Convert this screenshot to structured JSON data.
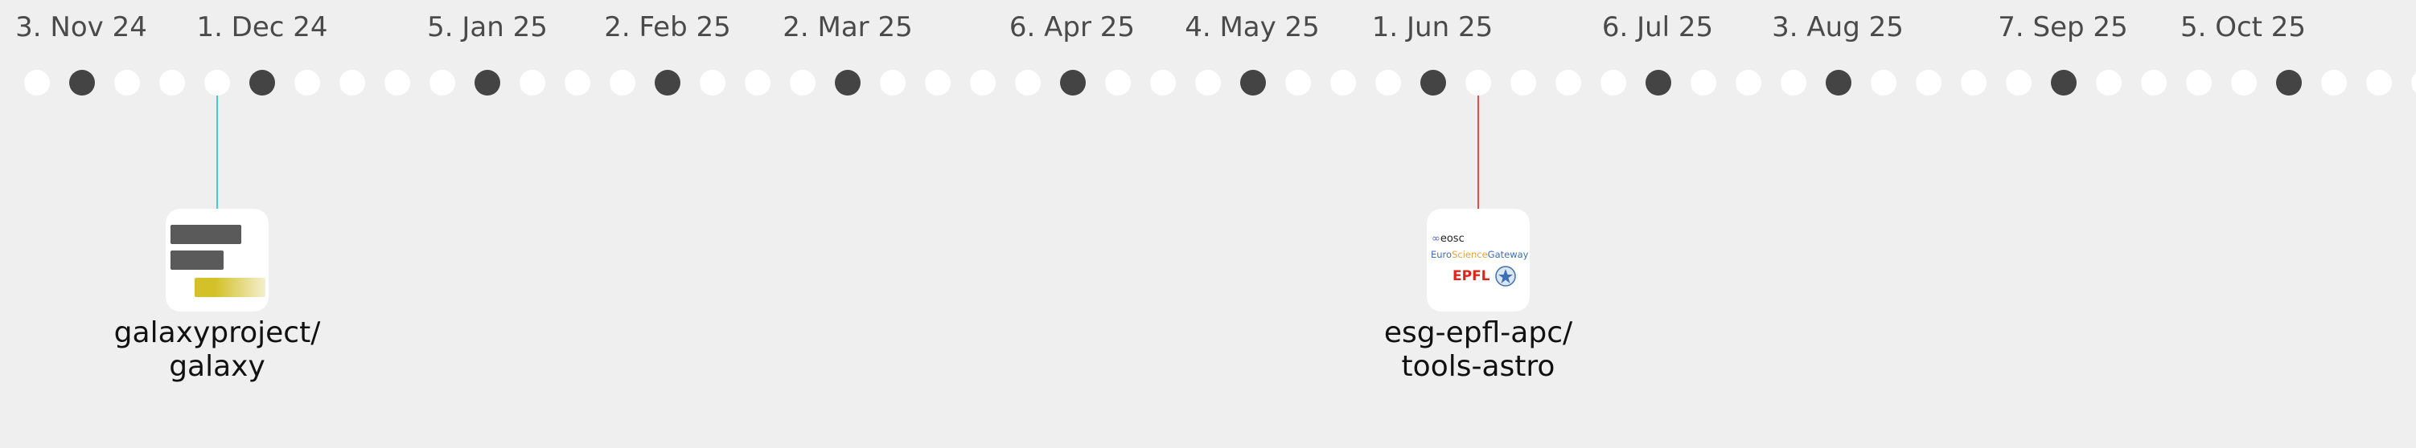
{
  "timeline": {
    "date_labels": [
      "3. Nov 24",
      "1. Dec 24",
      "5. Jan 25",
      "2. Feb 25",
      "2. Mar 25",
      "6. Apr 25",
      "4. May 25",
      "1. Jun 25",
      "6. Jul 25",
      "3. Aug 25",
      "7. Sep 25",
      "5. Oct 25"
    ],
    "dot_states": [
      0,
      1,
      0,
      0,
      0,
      1,
      0,
      0,
      0,
      0,
      1,
      0,
      0,
      0,
      1,
      0,
      0,
      0,
      1,
      0,
      0,
      0,
      0,
      1,
      0,
      0,
      0,
      1,
      0,
      0,
      0,
      1,
      0,
      0,
      0,
      0,
      1,
      0,
      0,
      0,
      1,
      0,
      0,
      0,
      0,
      1,
      0,
      0,
      0,
      0,
      1,
      0,
      0,
      0
    ]
  },
  "projects": [
    {
      "owner": "galaxyproject/",
      "repo": "galaxy",
      "stem_color": "#3fd0c9",
      "logo_icon": "galaxy-logo-icon"
    },
    {
      "owner": "esg-epfl-apc/",
      "repo": "tools-astro",
      "stem_color": "#e84a4a",
      "logo_icon": "eosc-epfl-logo-icon",
      "logo_text": {
        "eosc": "eosc",
        "gateway_1": "Euro",
        "gateway_2": "Science",
        "gateway_3": "Gateway",
        "epfl": "EPFL"
      }
    }
  ],
  "colors": {
    "background": "#efefef",
    "dot_empty": "#ffffff",
    "dot_filled": "#444444",
    "galaxy_gray": "#5a5a5a",
    "galaxy_gold": "#d4c12a"
  }
}
